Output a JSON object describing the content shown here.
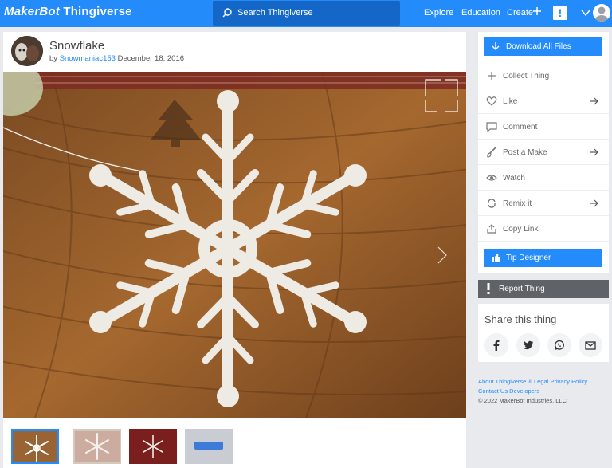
{
  "header": {
    "logo_prefix": "MakerBot",
    "logo_suffix": "Thingiverse",
    "search_placeholder": "Search Thingiverse",
    "nav": {
      "explore": "Explore",
      "education": "Education",
      "create": "Create"
    },
    "alert_glyph": "!"
  },
  "thing": {
    "title": "Snowflake",
    "by": "by",
    "author": "Snowmaniac153",
    "date": "December 18, 2016"
  },
  "thumbnails": [
    {
      "name": "thumb-snowflake-wood"
    },
    {
      "name": "thumb-snowflake-window"
    },
    {
      "name": "thumb-snowflake-red"
    },
    {
      "name": "thumb-text-print"
    }
  ],
  "sidebar": {
    "download": "Download All Files",
    "actions": [
      {
        "label": "Collect Thing",
        "icon": "plus-icon",
        "arrow": false
      },
      {
        "label": "Like",
        "icon": "heart-icon",
        "arrow": true
      },
      {
        "label": "Comment",
        "icon": "comment-icon",
        "arrow": false
      },
      {
        "label": "Post a Make",
        "icon": "brush-icon",
        "arrow": true
      },
      {
        "label": "Watch",
        "icon": "eye-icon",
        "arrow": false
      },
      {
        "label": "Remix it",
        "icon": "remix-icon",
        "arrow": true
      },
      {
        "label": "Copy Link",
        "icon": "share-icon",
        "arrow": false
      }
    ],
    "tip": "Tip Designer",
    "report": "Report Thing",
    "share_title": "Share this thing",
    "share_icons": [
      "facebook-icon",
      "twitter-icon",
      "whatsapp-icon",
      "mail-icon"
    ]
  },
  "footer": {
    "line1": "About Thingiverse ® Legal Privacy Policy",
    "line2": "Contact Us Developers",
    "copyright": "© 2022 MakerBot Industries, LLC"
  },
  "colors": {
    "brand": "#248bfb",
    "search_bg": "#1466c7",
    "report_bg": "#5f6367"
  }
}
